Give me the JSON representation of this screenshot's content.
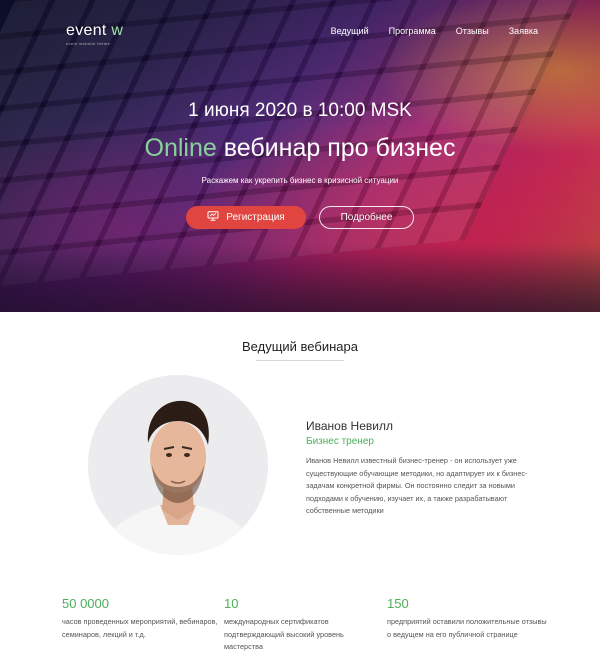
{
  "logo": {
    "main": "event",
    "accent": " w",
    "tagline": "event website theme"
  },
  "nav": [
    {
      "label": "Ведущий"
    },
    {
      "label": "Программа"
    },
    {
      "label": "Отзывы"
    },
    {
      "label": "Заявка"
    }
  ],
  "hero": {
    "date": "1 июня 2020 в 10:00 MSK",
    "title_accent": "Online",
    "title_rest": " вебинар про бизнес",
    "subtitle": "Раскажем как укрепить бизнес в кризисной ситуации",
    "register_label": "Регистрация",
    "more_label": "Подробнее"
  },
  "host_section": {
    "title": "Ведущий вебинара",
    "name": "Иванов Невилл",
    "role": "Бизнес тренер",
    "bio": "Иванов Невилл известный бизнес-тренер - он использует уже существующие обучающие методики, но адаптирует их к бизнес-задачам конкретной фирмы. Он постоянно следит за новыми подходами к обучению, изучает их, а также разрабатывают собственные методики"
  },
  "stats": [
    {
      "value": "50 0000",
      "desc": "часов проведенных мероприятий, вебинаров, семинаров, лекций и т.д."
    },
    {
      "value": "10",
      "desc": "международных сертификатов подтверждающий высокий уровень мастерства"
    },
    {
      "value": "150",
      "desc": "предприятий оставили положительные отзывы о ведущем на его публичной странице"
    }
  ],
  "colors": {
    "accent_green": "#4caf5a",
    "button_red": "#e0453f",
    "title_green": "#86d29a"
  },
  "icons": {
    "register": "presentation-icon"
  }
}
